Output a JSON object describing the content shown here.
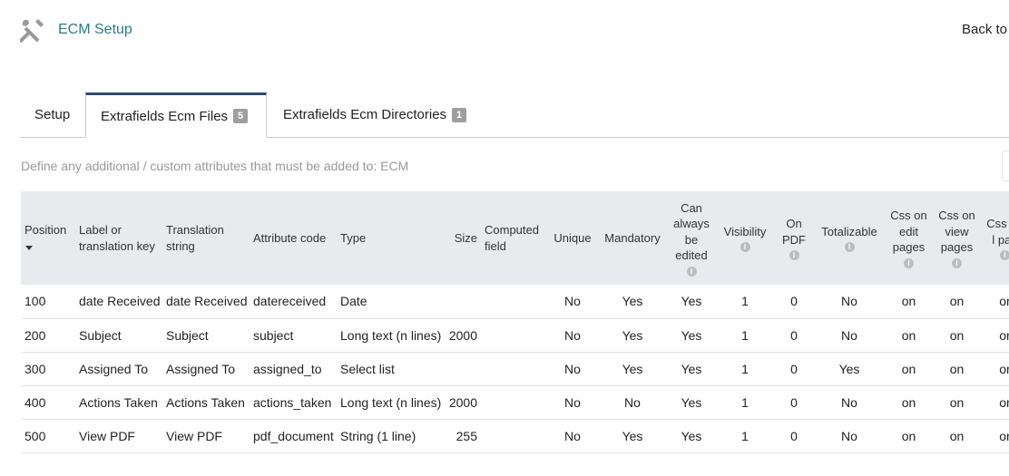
{
  "header": {
    "title": "ECM Setup",
    "back_link": "Back to",
    "icon": "wrench-screwdriver-icon"
  },
  "tabs": [
    {
      "label": "Setup"
    },
    {
      "label": "Extrafields Ecm Files",
      "badge": "5",
      "active": true
    },
    {
      "label": "Extrafields Ecm Directories",
      "badge": "1"
    }
  ],
  "description": "Define any additional / custom attributes that must be added to: ECM",
  "table": {
    "headers": {
      "position": "Position",
      "label": "Label or translation key",
      "translation": "Translation string",
      "attribute_code": "Attribute code",
      "type": "Type",
      "size": "Size",
      "computed": "Computed field",
      "unique": "Unique",
      "mandatory": "Mandatory",
      "can_edit": "Can always be edited",
      "visibility": "Visibility",
      "on_pdf": "On PDF",
      "totalizable": "Totalizable",
      "css_edit": "Css on edit pages",
      "css_view": "Css on view pages",
      "css_list": "Css on l pag"
    },
    "rows": [
      {
        "position": "100",
        "label": "date Received",
        "translation": "date Received",
        "code": "datereceived",
        "type": "Date",
        "size": "",
        "computed": "",
        "unique": "No",
        "mandatory": "Yes",
        "can_edit": "Yes",
        "visibility": "1",
        "on_pdf": "0",
        "totalizable": "No",
        "css_edit": "on",
        "css_view": "on",
        "css_list": "or"
      },
      {
        "position": "200",
        "label": "Subject",
        "translation": "Subject",
        "code": "subject",
        "type": "Long text (n lines)",
        "size": "2000",
        "computed": "",
        "unique": "No",
        "mandatory": "Yes",
        "can_edit": "Yes",
        "visibility": "1",
        "on_pdf": "0",
        "totalizable": "No",
        "css_edit": "on",
        "css_view": "on",
        "css_list": "or"
      },
      {
        "position": "300",
        "label": "Assigned To",
        "translation": "Assigned To",
        "code": "assigned_to",
        "type": "Select list",
        "size": "",
        "computed": "",
        "unique": "No",
        "mandatory": "Yes",
        "can_edit": "Yes",
        "visibility": "1",
        "on_pdf": "0",
        "totalizable": "Yes",
        "css_edit": "on",
        "css_view": "on",
        "css_list": "or"
      },
      {
        "position": "400",
        "label": "Actions Taken",
        "translation": "Actions Taken",
        "code": "actions_taken",
        "type": "Long text (n lines)",
        "size": "2000",
        "computed": "",
        "unique": "No",
        "mandatory": "No",
        "can_edit": "Yes",
        "visibility": "1",
        "on_pdf": "0",
        "totalizable": "No",
        "css_edit": "on",
        "css_view": "on",
        "css_list": "or"
      },
      {
        "position": "500",
        "label": "View PDF",
        "translation": "View PDF",
        "code": "pdf_document",
        "type": "String (1 line)",
        "size": "255",
        "computed": "",
        "unique": "No",
        "mandatory": "Yes",
        "can_edit": "Yes",
        "visibility": "1",
        "on_pdf": "0",
        "totalizable": "No",
        "css_edit": "on",
        "css_view": "on",
        "css_list": "or"
      }
    ]
  }
}
